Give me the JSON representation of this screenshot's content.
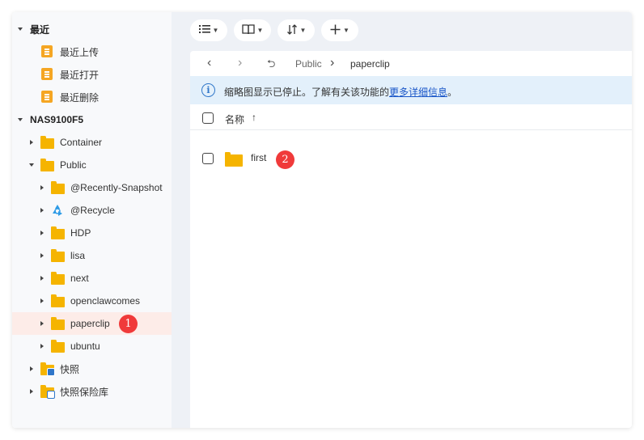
{
  "sidebar": {
    "recent_section": "最近",
    "recent_upload": "最近上传",
    "recent_open": "最近打开",
    "recent_delete": "最近删除",
    "nas_section": "NAS9100F5",
    "container": "Container",
    "public": "Public",
    "recently_snapshot": "@Recently-Snapshot",
    "recycle": "@Recycle",
    "hdp": "HDP",
    "lisa": "lisa",
    "next": "next",
    "openclawcomes": "openclawcomes",
    "paperclip": "paperclip",
    "ubuntu": "ubuntu",
    "snapshot": "快照",
    "snapshot_vault": "快照保险库",
    "annotation_1": "1"
  },
  "toolbar": {
    "list_view_icon": "list-icon",
    "book_icon": "book-icon",
    "sort_icon": "sort-icon",
    "add_icon": "plus-icon"
  },
  "path": {
    "back": "‹",
    "forward": "›",
    "up": "⮌",
    "crumb_public": "Public",
    "separator": "›",
    "crumb_current": "paperclip"
  },
  "info": {
    "text": "缩略图显示已停止。了解有关该功能的",
    "link": "更多详细信息",
    "suffix": "。"
  },
  "list": {
    "header_name": "名称",
    "sort_arrow": "↑",
    "rows": [
      {
        "name": "first"
      }
    ],
    "annotation_2": "2"
  },
  "colors": {
    "folder": "#f5b400",
    "accent_link": "#1a56c8",
    "selected_row": "#fdece8",
    "badge": "#f03a3a"
  }
}
